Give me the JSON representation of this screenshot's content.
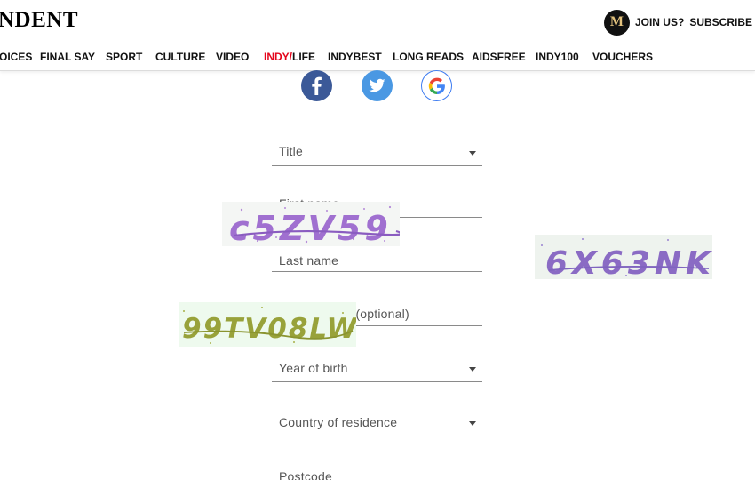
{
  "header": {
    "logo": "NDENT",
    "membership_badge": "M",
    "join_label": "JOIN US?",
    "subscribe_label": "SUBSCRIBE"
  },
  "nav": {
    "items": [
      "OICES",
      "FINAL SAY",
      "SPORT",
      "CULTURE",
      "VIDEO",
      "INDY/",
      "INDYBEST",
      "LONG READS",
      "AIDSFREE",
      "INDY100",
      "VOUCHERS"
    ],
    "indylife_suffix": "LIFE"
  },
  "social": {
    "icons": [
      "facebook-icon",
      "twitter-icon",
      "google-icon"
    ]
  },
  "form": {
    "title_label": "Title",
    "first_name_label": "First name",
    "last_name_label": "Last name",
    "middle_name_label": "Middle name (optional)",
    "year_label": "Year of birth",
    "country_label": "Country of residence",
    "postcode_label": "Postcode"
  },
  "captchas": {
    "c1_text": "c5ZV59",
    "c2_text": "6X63NK",
    "c3_text": "99TV08LW"
  },
  "colors": {
    "nav_accent_red": "#e4051b",
    "facebook_blue": "#3b5998",
    "twitter_blue": "#4a98e3",
    "captcha_purple": "#a070d0",
    "captcha_violet": "#8a6bc4",
    "captcha_olive": "#98a23a",
    "badge_gold": "#e3c27d"
  }
}
